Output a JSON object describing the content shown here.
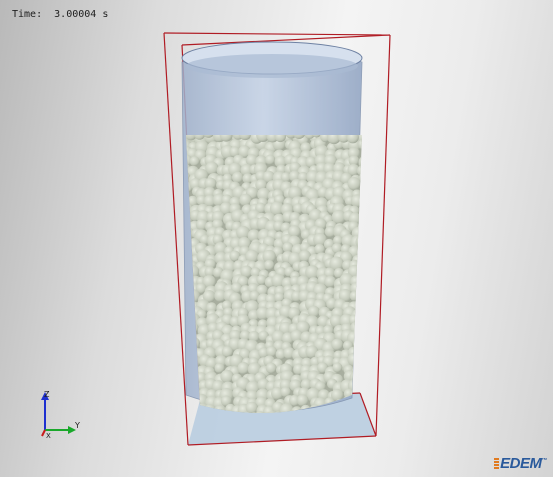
{
  "viewer": {
    "time_label": "Time:",
    "time_value": "3.00004 s",
    "logo_text": "EDEM",
    "logo_mark": "™",
    "background_colors": {
      "edge": "#b9b9b9",
      "center": "#f4f4f4"
    }
  },
  "scene": {
    "domain_box_color": "#b01c24",
    "cylinder_color": "#aebfd6",
    "particle_color": "#c7cdbf",
    "floor_color": "#b9cde0"
  },
  "axis_triad": {
    "z_label": "Z",
    "y_label": "Y",
    "x_label": "X",
    "z_color": "#1d2fd0",
    "y_color": "#1aa82b",
    "x_color": "#c81c1c"
  }
}
